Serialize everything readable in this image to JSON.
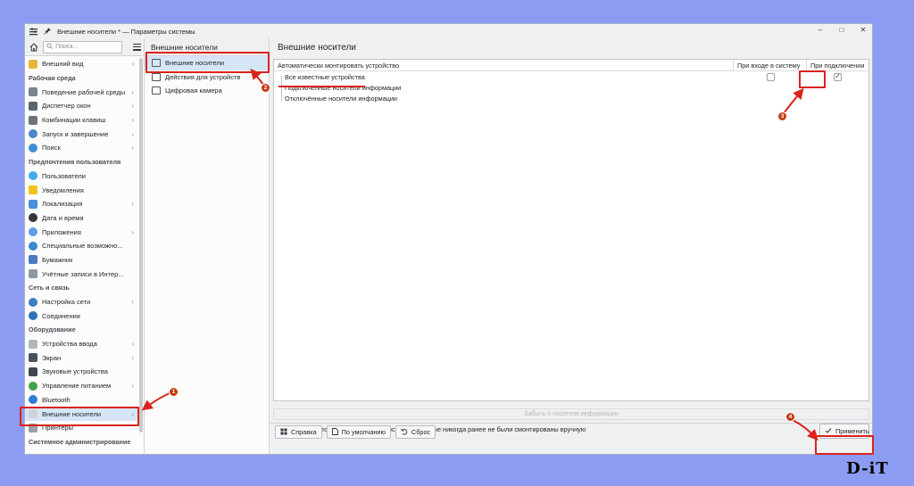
{
  "window": {
    "title": "Внешние носители * — Параметры системы",
    "controls": [
      "‒",
      "□",
      "✕"
    ]
  },
  "sidebar": {
    "search_placeholder": "Поиск...",
    "items": [
      {
        "type": "item",
        "label": "Внешний вид",
        "icon": "appearance-icon",
        "color": "#e8b43a",
        "chevron": true
      },
      {
        "type": "heading",
        "label": "Рабочая среда"
      },
      {
        "type": "item",
        "label": "Поведение рабочей среды",
        "icon": "desktop-behavior-icon",
        "color": "#7c8591",
        "chevron": true
      },
      {
        "type": "item",
        "label": "Диспетчер окон",
        "icon": "window-manager-icon",
        "color": "#5a6470",
        "chevron": true
      },
      {
        "type": "item",
        "label": "Комбинации клавиш",
        "icon": "keyboard-icon",
        "color": "#6a737d",
        "chevron": true
      },
      {
        "type": "item",
        "label": "Запуск и завершение",
        "icon": "startup-icon",
        "color": "#4b86c8",
        "chevron": true
      },
      {
        "type": "item",
        "label": "Поиск",
        "icon": "search-icon",
        "color": "#3d8fd6",
        "chevron": true
      },
      {
        "type": "heading",
        "label": "Предпочтения пользователя"
      },
      {
        "type": "item",
        "label": "Пользователи",
        "icon": "users-icon",
        "color": "#3daee9",
        "chevron": false
      },
      {
        "type": "item",
        "label": "Уведомления",
        "icon": "bell-icon",
        "color": "#f4c21d",
        "chevron": false
      },
      {
        "type": "item",
        "label": "Локализация",
        "icon": "localization-icon",
        "color": "#4a90d9",
        "chevron": true
      },
      {
        "type": "item",
        "label": "Дата и время",
        "icon": "clock-icon",
        "color": "#31363b",
        "chevron": false
      },
      {
        "type": "item",
        "label": "Приложения",
        "icon": "apps-icon",
        "color": "#5c9ee6",
        "chevron": true
      },
      {
        "type": "item",
        "label": "Специальные возможно...",
        "icon": "accessibility-icon",
        "color": "#3a88d0",
        "chevron": false
      },
      {
        "type": "item",
        "label": "Бумажник",
        "icon": "wallet-icon",
        "color": "#4b7bc0",
        "chevron": false
      },
      {
        "type": "item",
        "label": "Учётные записи в Интер...",
        "icon": "online-accounts-icon",
        "color": "#8d98a6",
        "chevron": false
      },
      {
        "type": "heading",
        "label": "Сеть и связь"
      },
      {
        "type": "item",
        "label": "Настройка сети",
        "icon": "network-icon",
        "color": "#3c7fc4",
        "chevron": true
      },
      {
        "type": "item",
        "label": "Соединения",
        "icon": "connections-icon",
        "color": "#2e72b8",
        "chevron": false
      },
      {
        "type": "heading",
        "label": "Оборудование"
      },
      {
        "type": "item",
        "label": "Устройства ввода",
        "icon": "mouse-icon",
        "color": "#b0b6bd",
        "chevron": true
      },
      {
        "type": "item",
        "label": "Экран",
        "icon": "display-icon",
        "color": "#4a5260",
        "chevron": true
      },
      {
        "type": "item",
        "label": "Звуковые устройства",
        "icon": "audio-icon",
        "color": "#40464d",
        "chevron": false
      },
      {
        "type": "item",
        "label": "Управление питанием",
        "icon": "power-icon",
        "color": "#43a047",
        "chevron": true
      },
      {
        "type": "item",
        "label": "Bluetooth",
        "icon": "bluetooth-icon",
        "color": "#2f7bd6",
        "chevron": false
      },
      {
        "type": "item",
        "label": "Внешние носители",
        "icon": "removable-media-icon",
        "color": "#d0d3d7",
        "chevron": true,
        "selected": true
      },
      {
        "type": "item",
        "label": "Принтеры",
        "icon": "printer-icon",
        "color": "#9aa1a9",
        "chevron": false
      },
      {
        "type": "heading",
        "label": "Системное администрирование"
      }
    ]
  },
  "middle": {
    "title": "Внешние носители",
    "items": [
      {
        "label": "Внешние носители",
        "icon": "removable-media-icon",
        "selected": true
      },
      {
        "label": "Действия для устройств",
        "icon": "device-actions-icon",
        "selected": false
      },
      {
        "label": "Цифровая камера",
        "icon": "camera-icon",
        "selected": false
      }
    ]
  },
  "content": {
    "title": "Внешние носители",
    "columns": [
      "Автоматически монтировать устройство",
      "При входе в систему",
      "При подключении"
    ],
    "rows": [
      {
        "label": "Все известные устройства",
        "login": false,
        "attach": true
      },
      {
        "label": "Подключённые носители информации",
        "login": null,
        "attach": null
      },
      {
        "label": "Отключённые носители информации",
        "login": null,
        "attach": null
      }
    ],
    "forget_button": "Забыть о носителе информации",
    "auto_new_label": "Автоматически монтировать те носители, которые никогда ранее не были смонтированы вручную",
    "auto_new_checked": false
  },
  "footer": {
    "help": "Справка",
    "defaults": "По умолчанию",
    "reset": "Сброс",
    "apply": "Применить"
  },
  "annotations": {
    "color": "#d9231d",
    "badges": [
      "1",
      "2",
      "3",
      "4"
    ]
  },
  "watermark": "D-iT"
}
